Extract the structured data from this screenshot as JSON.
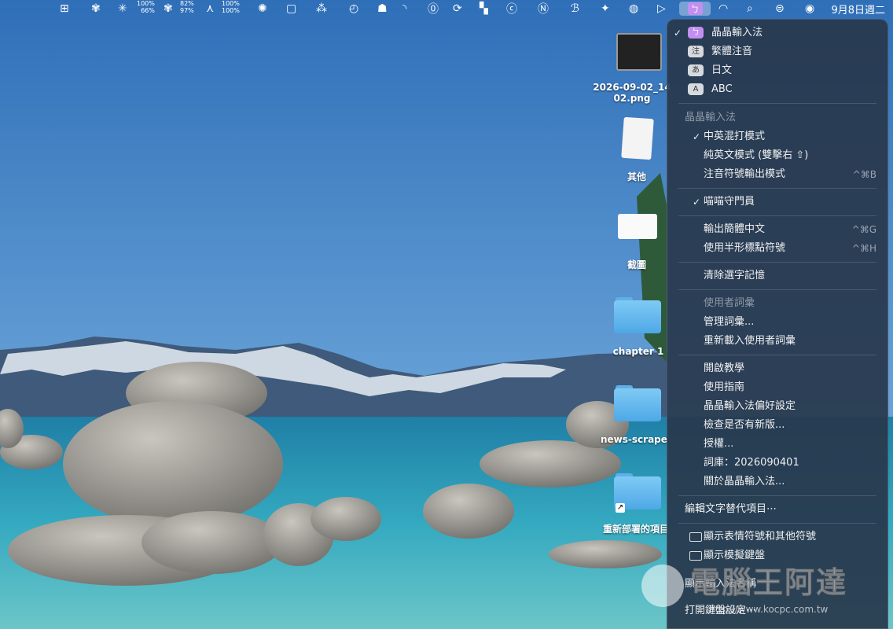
{
  "menubar": {
    "clock": "9月8日週二",
    "stats": [
      {
        "top": "100%",
        "bottom": "66%"
      },
      {
        "top": "82%",
        "bottom": "97%"
      },
      {
        "top": "100%",
        "bottom": "100%"
      }
    ]
  },
  "desktop": {
    "items": [
      {
        "label_line1": "2026-09-02_14",
        "label_line2": "02.png"
      },
      {
        "label": "其他"
      },
      {
        "label": "截圖"
      },
      {
        "label": "chapter 1"
      },
      {
        "label": "news-scrape"
      },
      {
        "label": "重新部署的項目"
      }
    ]
  },
  "menu": {
    "input_sources": [
      {
        "label": "晶晶輸入法",
        "badge": "ㄅ",
        "checked": true
      },
      {
        "label": "繁體注音",
        "badge": "注"
      },
      {
        "label": "日文",
        "badge": "あ"
      },
      {
        "label": "ABC",
        "badge": "A"
      }
    ],
    "section_title": "晶晶輸入法",
    "modes": [
      {
        "label": "中英混打模式",
        "checked": true
      },
      {
        "label": "純英文模式 (雙擊右 ⇧)"
      },
      {
        "label": "注音符號輸出模式",
        "shortcut": "^⌘B"
      }
    ],
    "guard": {
      "label": "喵喵守門員",
      "checked": true
    },
    "output": [
      {
        "label": "輸出簡體中文",
        "shortcut": "^⌘G"
      },
      {
        "label": "使用半形標點符號",
        "shortcut": "^⌘H"
      }
    ],
    "clear_memory": "清除選字記憶",
    "user_dict_header": "使用者詞彙",
    "user_dict": [
      {
        "label": "管理詞彙..."
      },
      {
        "label": "重新載入使用者詞彙"
      }
    ],
    "help": [
      {
        "label": "開啟教學"
      },
      {
        "label": "使用指南"
      },
      {
        "label": "晶晶輸入法偏好設定"
      },
      {
        "label": "檢查是否有新版..."
      },
      {
        "label": "授權..."
      },
      {
        "label": "詞庫：2026090401"
      },
      {
        "label": "關於晶晶輸入法..."
      }
    ],
    "edit_text_replacement": "編輯文字替代項目⋯",
    "show_emoji": "顯示表情符號和其他符號",
    "show_keyboard": "顯示模擬鍵盤",
    "show_input_name": "顯示輸入法名稱",
    "open_keyboard_settings": "打開鍵盤設定⋯"
  },
  "watermark": {
    "title": "電腦王阿達",
    "url": "http://www.kocpc.com.tw"
  },
  "colors": {
    "sky_top": "#3a7fc4",
    "sky_bottom": "#7cb8e6",
    "lake": "#2a9bb5",
    "menu_bg": "#2b3a4e",
    "accent": "#c28ff0"
  }
}
